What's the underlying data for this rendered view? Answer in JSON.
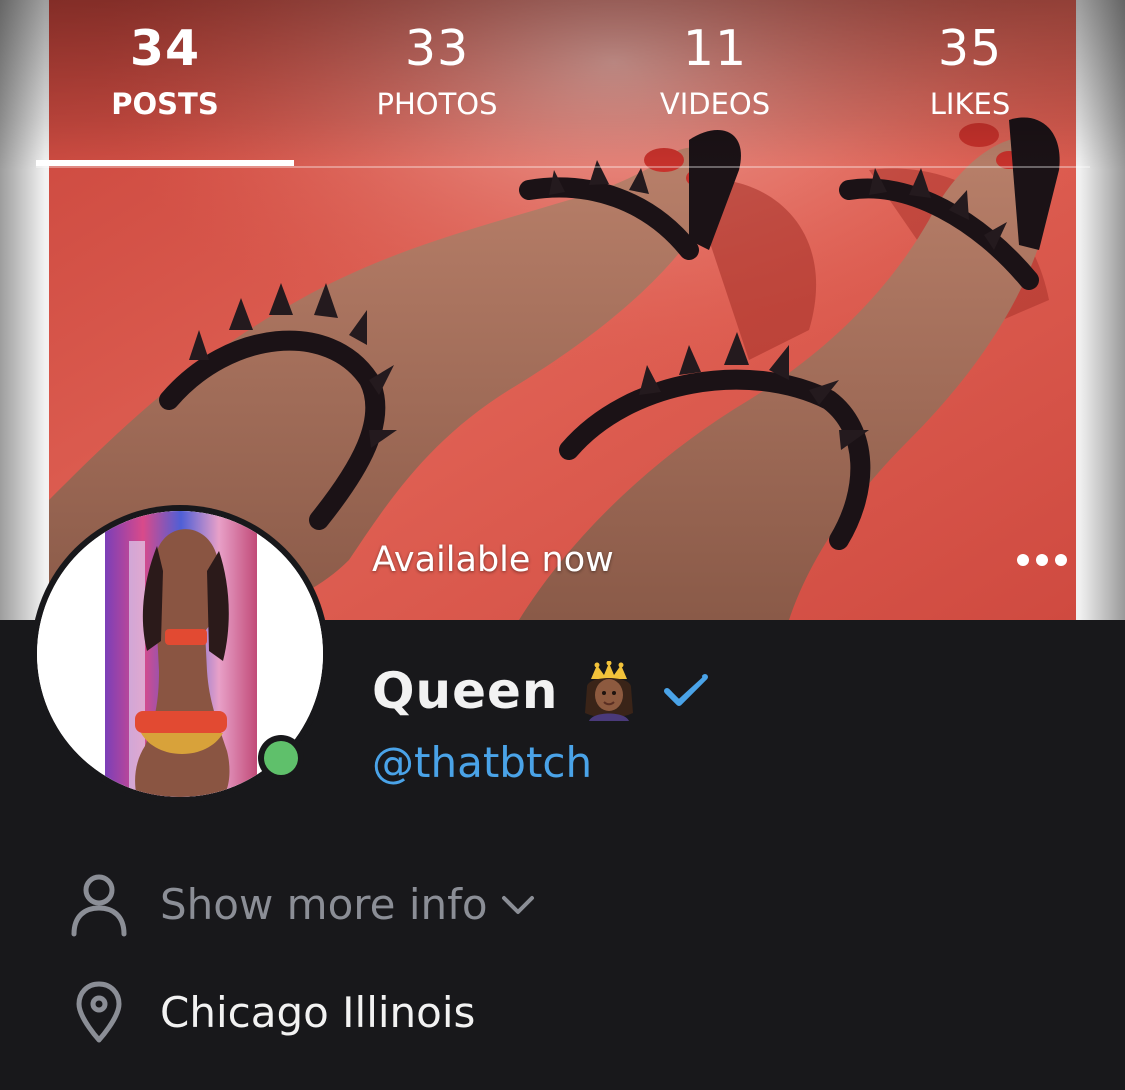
{
  "profile_tabs": [
    {
      "count": "34",
      "label": "POSTS",
      "active": true
    },
    {
      "count": "33",
      "label": "PHOTOS",
      "active": false
    },
    {
      "count": "11",
      "label": "VIDEOS",
      "active": false
    },
    {
      "count": "35",
      "label": "LIKES",
      "active": false
    }
  ],
  "cover": {
    "status_text": "Available now",
    "more_icon": "ellipsis-horizontal-icon"
  },
  "profile": {
    "display_name": "Queen",
    "name_emoji": "crown-princess-emoji",
    "verified_icon": "verified-check-icon",
    "username": "@thatbtch",
    "online": true
  },
  "info": {
    "show_more_label": "Show more info",
    "show_more_icon": "user-icon",
    "chevron_icon": "chevron-down-icon",
    "location": "Chicago Illinois",
    "location_icon": "map-pin-icon"
  },
  "colors": {
    "background": "#18181b",
    "username_blue": "#4aa3e8",
    "online_green": "#5fc06b",
    "muted_text": "#8b8e96"
  }
}
